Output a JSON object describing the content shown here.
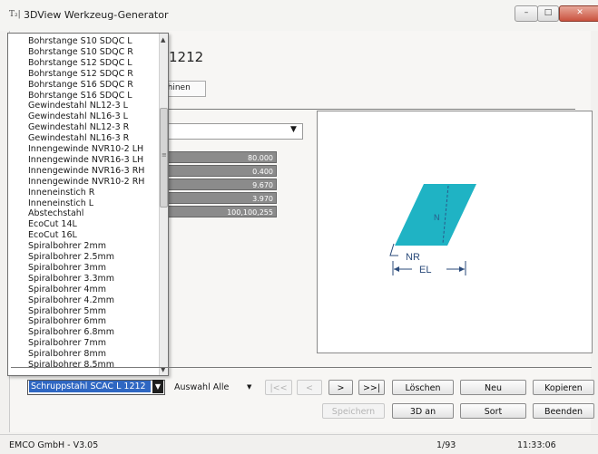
{
  "window": {
    "icon_text": "T₂|",
    "title": "3DView Werkzeug-Generator",
    "min_symbol": "–",
    "max_symbol": "□",
    "close_symbol": "✕"
  },
  "background": {
    "heading": "1212",
    "tab_label": "schinen",
    "value_cells": [
      "80.000",
      "0.400",
      "9.670",
      "3.970",
      "100,100,255"
    ]
  },
  "tool_list": {
    "items": [
      "Bohrstange S10 SDQC L",
      "Bohrstange S10 SDQC R",
      "Bohrstange S12 SDQC L",
      "Bohrstange S12 SDQC R",
      "Bohrstange S16 SDQC R",
      "Bohrstange S16 SDQC L",
      "Gewindestahl NL12-3 L",
      "Gewindestahl NL16-3 L",
      "Gewindestahl NL12-3 R",
      "Gewindestahl NL16-3 R",
      "Innengewinde NVR10-2 LH",
      "Innengewinde NVR16-3 LH",
      "Innengewinde NVR16-3 RH",
      "Innengewinde NVR10-2 RH",
      "Inneneinstich R",
      "Inneneinstich L",
      "Abstechstahl",
      "EcoCut 14L",
      "EcoCut 16L",
      "Spiralbohrer 2mm",
      "Spiralbohrer 2.5mm",
      "Spiralbohrer 3mm",
      "Spiralbohrer 3.3mm",
      "Spiralbohrer 4mm",
      "Spiralbohrer 4.2mm",
      "Spiralbohrer 5mm",
      "Spiralbohrer 6mm",
      "Spiralbohrer 6.8mm",
      "Spiralbohrer 7mm",
      "Spiralbohrer 8mm",
      "Spiralbohrer 8.5mm"
    ]
  },
  "preview": {
    "insert_color": "#1fb3c4",
    "label_nr": "NR",
    "label_el": "EL",
    "label_angle": "N"
  },
  "controls": {
    "selected_tool": "Schruppstahl SCAC L 1212",
    "filter_label": "Auswahl Alle",
    "nav_first": "|<<",
    "nav_prev": "<",
    "nav_next": ">",
    "nav_last": ">>|",
    "delete": "Löschen",
    "new": "Neu",
    "copy": "Kopieren",
    "save": "Speichern",
    "threed": "3D an",
    "sort": "Sort",
    "quit": "Beenden"
  },
  "status": {
    "company": "EMCO GmbH  -  V3.05",
    "record": "1/93",
    "time": "11:33:06"
  }
}
